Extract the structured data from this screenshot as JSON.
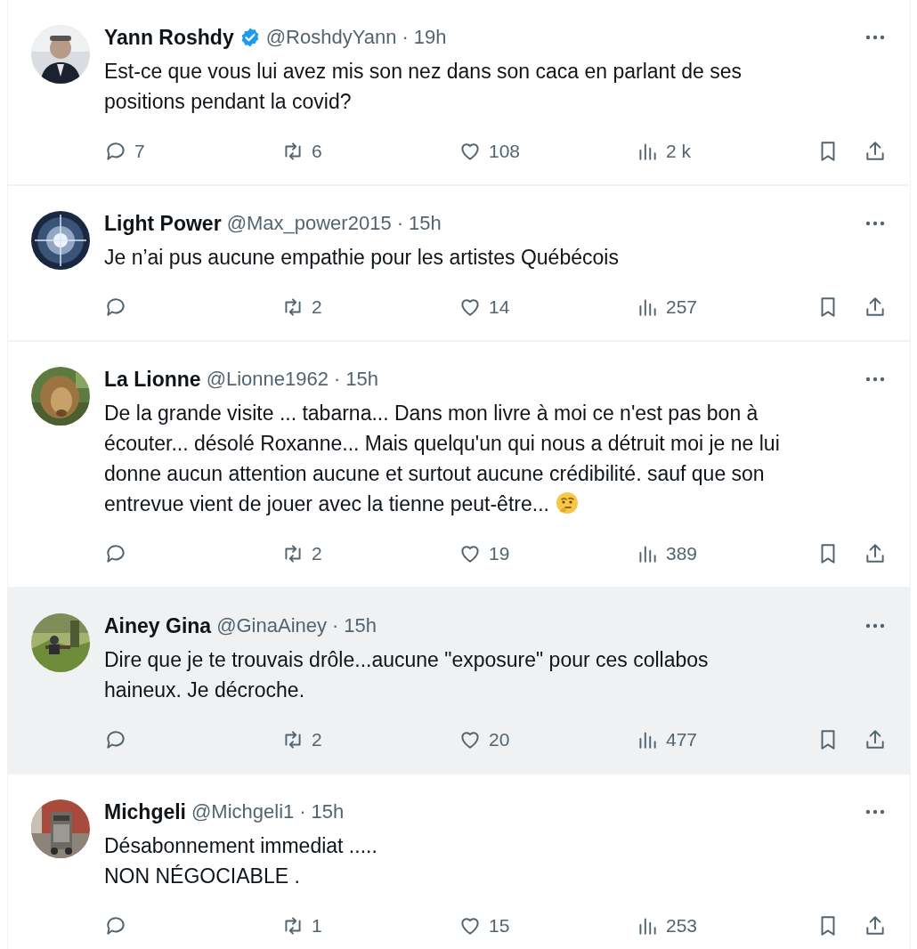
{
  "tweets": [
    {
      "author": "Yann Roshdy",
      "verified": true,
      "handle": "@RoshdyYann",
      "separator": "·",
      "time": "19h",
      "highlighted": false,
      "has_emoji": false,
      "avatar": {
        "kind": "picture"
      },
      "text": [
        "Est-ce que vous lui avez mis son nez dans son caca en parlant de ses",
        "positions pendant la covid?"
      ],
      "stats": {
        "replies": "7",
        "reposts": "6",
        "likes": "108",
        "views": "2 k"
      }
    },
    {
      "author": "Light Power",
      "verified": false,
      "handle": "@Max_power2015",
      "separator": "·",
      "time": "15h",
      "highlighted": false,
      "has_emoji": false,
      "avatar": {
        "kind": "picture"
      },
      "text": [
        "Je n’ai pus aucune empathie pour les artistes Québécois"
      ],
      "stats": {
        "reposts": "2",
        "likes": "14",
        "views": "257"
      }
    },
    {
      "author": "La Lionne",
      "verified": false,
      "handle": "@Lionne1962",
      "separator": "·",
      "time": "15h",
      "highlighted": false,
      "has_emoji": true,
      "avatar": {
        "kind": "picture"
      },
      "text": [
        "De la grande visite ... tabarna... Dans mon livre à moi ce n'est pas bon à",
        "écouter... désolé Roxanne... Mais quelqu'un qui nous a détruit moi je ne lui",
        "donne aucun attention aucune et surtout aucune crédibilité. sauf que son",
        "entrevue vient de jouer avec la tienne peut-être..."
      ],
      "stats": {
        "reposts": "2",
        "likes": "19",
        "views": "389"
      }
    },
    {
      "author": "Ainey Gina",
      "verified": false,
      "handle": "@GinaAiney",
      "separator": "·",
      "time": "15h",
      "highlighted": true,
      "has_emoji": false,
      "avatar": {
        "kind": "picture"
      },
      "text": [
        "Dire que je te trouvais drôle...aucune \"exposure\" pour ces collabos",
        "haineux. Je décroche."
      ],
      "stats": {
        "reposts": "2",
        "likes": "20",
        "views": "477"
      }
    },
    {
      "author": "Michgeli",
      "verified": false,
      "handle": "@Michgeli1",
      "separator": "·",
      "time": "15h",
      "highlighted": false,
      "has_emoji": false,
      "avatar": {
        "kind": "picture"
      },
      "text": [
        "Désabonnement immediat .....",
        "NON NÉGOCIABLE ."
      ],
      "stats": {
        "reposts": "1",
        "likes": "15",
        "views": "253"
      }
    }
  ]
}
